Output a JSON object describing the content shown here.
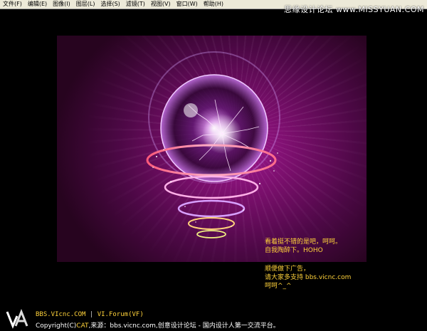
{
  "menu": {
    "items": [
      "文件(F)",
      "编辑(E)",
      "图像(I)",
      "图层(L)",
      "选择(S)",
      "滤镜(T)",
      "视图(V)",
      "窗口(W)",
      "帮助(H)"
    ]
  },
  "watermark": "思缘设计论坛 www.MISSYUAN.COM",
  "canvas_notes": {
    "block1": [
      "看着挺不错的是吧，呵呵。",
      "自我陶醉下。HOHO"
    ],
    "block2": [
      "顺便做下广告，",
      "请大家多支持 bbs.vicnc.com",
      "呵呵^_^"
    ]
  },
  "footer": {
    "logo_icon": "va-logo-icon",
    "line1": {
      "part1": "BBS.VIcnc.COM",
      "sep": " | ",
      "part2": "VI.Forum(VF)"
    },
    "line2": {
      "prefix": "Copyright(C)",
      "cat": "CAT",
      "rest": ",来源：bbs.vicnc.com,创意设计论坛 - 国内设计人第一交流平台。"
    }
  },
  "colors": {
    "note_text": "#ffd23a",
    "canvas_center": "#a01890",
    "canvas_edge": "#27041f"
  }
}
